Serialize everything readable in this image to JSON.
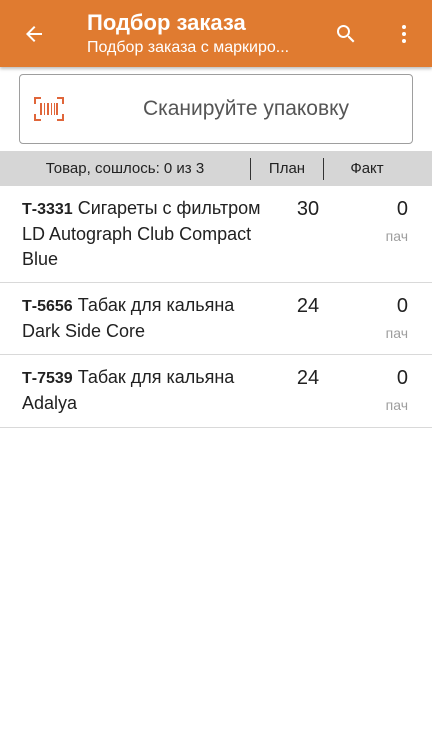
{
  "appbar": {
    "title": "Подбор заказа",
    "subtitle": "Подбор заказа с маркиро...",
    "back_icon": "arrow-back-icon",
    "search_icon": "search-icon",
    "menu_icon": "more-vert-icon",
    "color": "#e07b30"
  },
  "scan": {
    "label": "Сканируйте упаковку",
    "icon": "barcode-scan-icon",
    "icon_color": "#e0663a"
  },
  "table": {
    "header": {
      "goods": "Товар, сошлось: 0 из 3",
      "plan": "План",
      "fact": "Факт"
    },
    "rows": [
      {
        "article": "Т-3331",
        "name": "Сигареты с фильтром LD Autograph Club Compact Blue",
        "plan": "30",
        "fact": "0",
        "unit": "пач"
      },
      {
        "article": "Т-5656",
        "name": "Табак для кальяна Dark Side Core",
        "plan": "24",
        "fact": "0",
        "unit": "пач"
      },
      {
        "article": "Т-7539",
        "name": "Табак для кальяна Adalya",
        "plan": "24",
        "fact": "0",
        "unit": "пач"
      }
    ]
  }
}
